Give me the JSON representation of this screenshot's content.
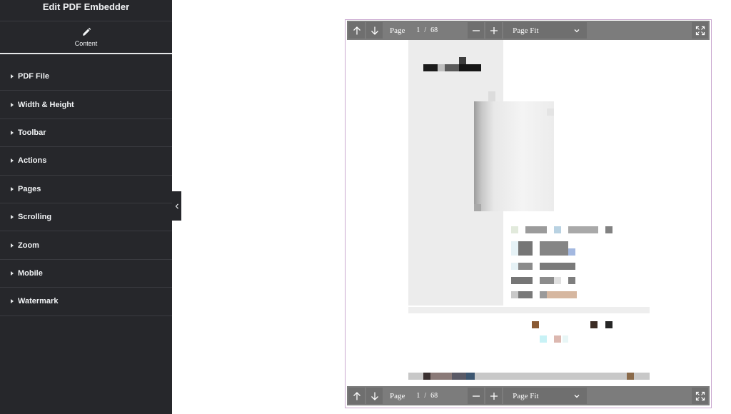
{
  "editor": {
    "title": "Edit PDF Embedder",
    "tabs": [
      {
        "label": "Content",
        "icon": "pencil-icon"
      }
    ],
    "sections": [
      {
        "label": "PDF File"
      },
      {
        "label": "Width & Height"
      },
      {
        "label": "Toolbar"
      },
      {
        "label": "Actions"
      },
      {
        "label": "Pages"
      },
      {
        "label": "Scrolling"
      },
      {
        "label": "Zoom"
      },
      {
        "label": "Mobile"
      },
      {
        "label": "Watermark"
      }
    ],
    "collapse_icon": "chevron-left-icon"
  },
  "viewer": {
    "toolbar_top": {
      "page_label": "Page",
      "current_page": "1",
      "separator": "/",
      "page_count": "68",
      "zoom_select": "Page Fit"
    },
    "toolbar_bottom": {
      "page_label": "Page",
      "current_page": "1",
      "separator": "/",
      "page_count": "68",
      "zoom_select": "Page Fit"
    },
    "icons": [
      "arrow-up-icon",
      "arrow-down-icon",
      "minus-icon",
      "plus-icon",
      "chevron-down-icon",
      "fullscreen-icon"
    ],
    "colors": {
      "toolbar": "#7c7c7c",
      "button": "#6f6f6f",
      "border": "#c9a7cf",
      "sidebar": "#26272b"
    }
  }
}
